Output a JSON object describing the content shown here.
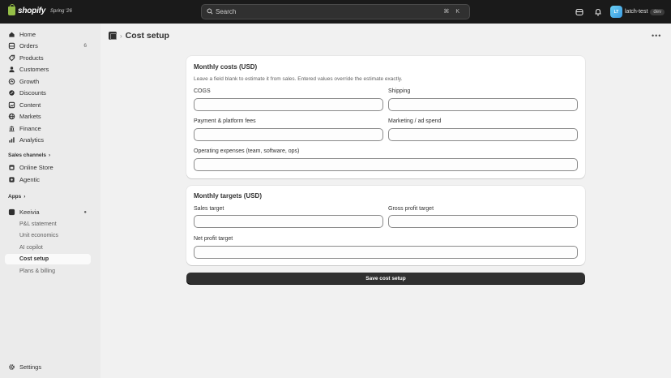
{
  "topbar": {
    "brand": "shopify",
    "edition": "Spring '26",
    "search_placeholder": "Search",
    "search_shortcut": "⌘ K",
    "store_initials": "LT",
    "store_name": "latch-test",
    "store_badge": "dev"
  },
  "sidebar": {
    "nav": [
      {
        "label": "Home",
        "icon": "home-icon"
      },
      {
        "label": "Orders",
        "icon": "orders-icon",
        "count": "6"
      },
      {
        "label": "Products",
        "icon": "products-icon"
      },
      {
        "label": "Customers",
        "icon": "customers-icon"
      },
      {
        "label": "Growth",
        "icon": "growth-icon"
      },
      {
        "label": "Discounts",
        "icon": "discounts-icon"
      },
      {
        "label": "Content",
        "icon": "content-icon"
      },
      {
        "label": "Markets",
        "icon": "markets-icon"
      },
      {
        "label": "Finance",
        "icon": "finance-icon"
      },
      {
        "label": "Analytics",
        "icon": "analytics-icon"
      }
    ],
    "sales_channels_label": "Sales channels",
    "channels": [
      {
        "label": "Online Store",
        "icon": "online-store-icon"
      },
      {
        "label": "Agentic",
        "icon": "agentic-icon"
      }
    ],
    "apps_label": "Apps",
    "app_name": "Keeivia",
    "app_items": [
      {
        "label": "P&L statement"
      },
      {
        "label": "Unit economics"
      },
      {
        "label": "AI copilot"
      },
      {
        "label": "Cost setup",
        "active": true
      },
      {
        "label": "Plans & billing"
      }
    ],
    "settings_label": "Settings"
  },
  "page": {
    "title": "Cost setup",
    "breadcrumb_sep": "›"
  },
  "costs_card": {
    "title": "Monthly costs (USD)",
    "help": "Leave a field blank to estimate it from sales. Entered values override the estimate exactly.",
    "fields": {
      "cogs": {
        "label": "COGS",
        "value": ""
      },
      "shipping": {
        "label": "Shipping",
        "value": ""
      },
      "payment": {
        "label": "Payment & platform fees",
        "value": ""
      },
      "marketing": {
        "label": "Marketing / ad spend",
        "value": ""
      },
      "opex": {
        "label": "Operating expenses (team, software, ops)",
        "value": ""
      }
    }
  },
  "targets_card": {
    "title": "Monthly targets (USD)",
    "fields": {
      "sales": {
        "label": "Sales target",
        "value": ""
      },
      "gross": {
        "label": "Gross profit target",
        "value": ""
      },
      "net": {
        "label": "Net profit target",
        "value": ""
      }
    }
  },
  "save_label": "Save cost setup",
  "colors": {
    "topbar": "#1a1a1a",
    "sidebar": "#ebebeb",
    "background": "#f1f1f1",
    "primary_button": "#303030"
  }
}
